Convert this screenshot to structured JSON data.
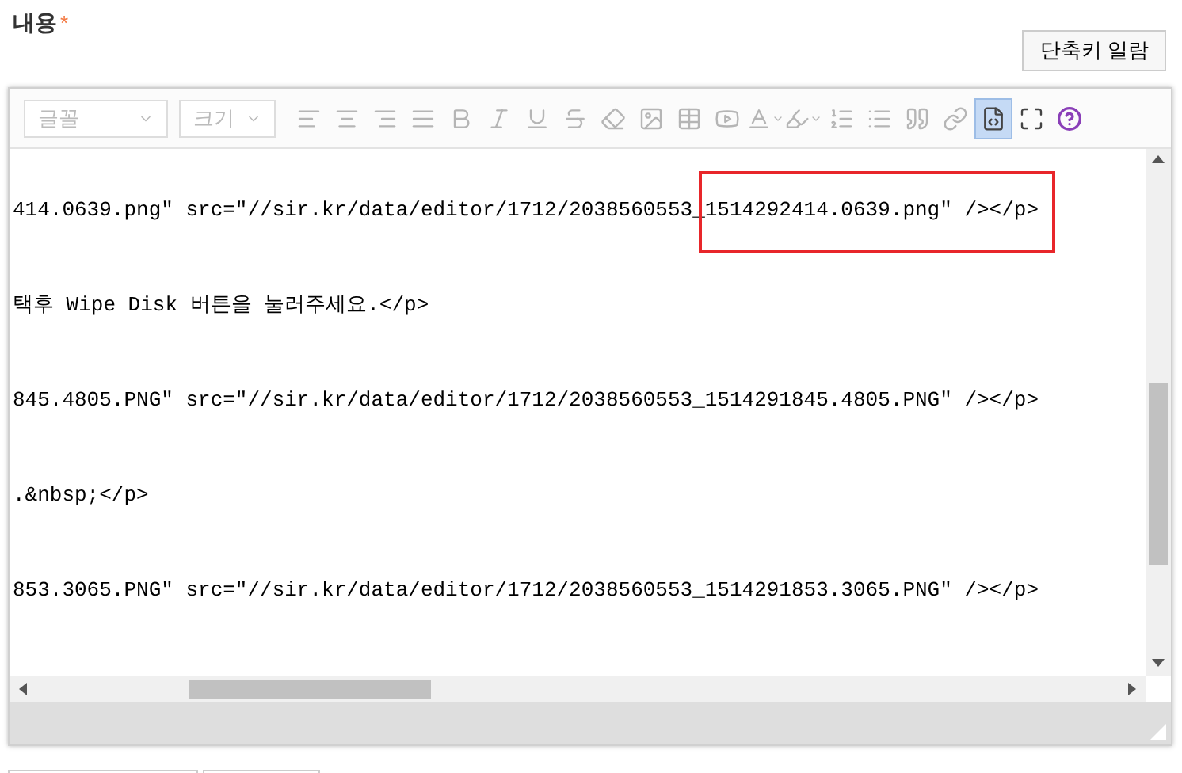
{
  "field": {
    "label": "내용",
    "required_mark": "*"
  },
  "shortcut_button": "단축키 일람",
  "toolbar": {
    "selects": [
      {
        "placeholder": "글꼴",
        "disabled": true
      },
      {
        "placeholder": "크기",
        "disabled": true
      }
    ],
    "buttons": [
      {
        "disabled": true,
        "selected": false
      },
      {
        "disabled": true,
        "selected": false
      },
      {
        "disabled": true,
        "selected": false
      },
      {
        "disabled": true,
        "selected": false
      },
      {
        "disabled": true,
        "selected": false
      },
      {
        "disabled": true,
        "selected": false
      },
      {
        "disabled": true,
        "selected": false
      },
      {
        "disabled": true,
        "selected": false
      },
      {
        "disabled": true,
        "selected": false
      },
      {
        "disabled": true,
        "selected": false
      },
      {
        "disabled": true,
        "selected": false
      },
      {
        "disabled": true,
        "selected": false
      },
      {
        "disabled": true,
        "selected": false
      },
      {
        "disabled": true,
        "selected": false
      },
      {
        "disabled": true,
        "selected": false
      },
      {
        "disabled": true,
        "selected": false
      },
      {
        "disabled": true,
        "selected": false
      },
      {
        "disabled": true,
        "selected": false
      },
      {
        "disabled": false,
        "selected": true
      },
      {
        "disabled": false,
        "selected": false
      },
      {
        "disabled": false,
        "selected": false
      }
    ]
  },
  "source_lines": [
    "414.0639.png\" src=\"//sir.kr/data/editor/1712/2038560553_1514292414.0639.png\" /></p>",
    "택후 Wipe Disk 버튼을 눌러주세요.</p>",
    "845.4805.PNG\" src=\"//sir.kr/data/editor/1712/2038560553_1514291845.4805.PNG\" /></p>",
    ".&nbsp;</p>",
    "853.3065.PNG\" src=\"//sir.kr/data/editor/1712/2038560553_1514291853.3065.PNG\" /></p>"
  ]
}
